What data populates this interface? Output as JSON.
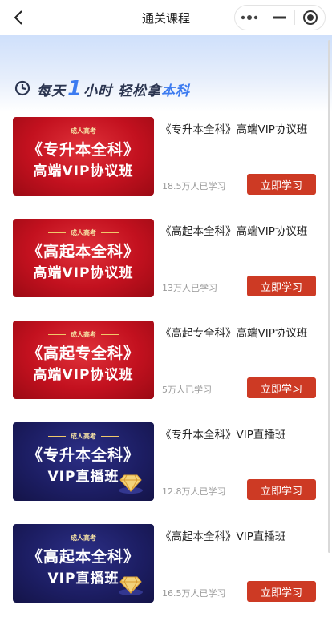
{
  "nav": {
    "title": "通关课程",
    "back_icon": "chevron-left-icon",
    "capsule": [
      "more-icon",
      "minimize-icon",
      "close-target-icon"
    ]
  },
  "slogan": {
    "prefix": "每天",
    "number": "1",
    "middle": "小时 轻松拿",
    "accent": "本科"
  },
  "courses": [
    {
      "cover_theme": "red",
      "cover_tag": "成人高考",
      "cover_line1": "《专升本全科》",
      "cover_line2": "高端VIP协议班",
      "title": "《专升本全科》高端VIP协议班",
      "learners": "18.5万人已学习",
      "button": "立即学习"
    },
    {
      "cover_theme": "red",
      "cover_tag": "成人高考",
      "cover_line1": "《高起本全科》",
      "cover_line2": "高端VIP协议班",
      "title": "《高起本全科》高端VIP协议班",
      "learners": "13万人已学习",
      "button": "立即学习"
    },
    {
      "cover_theme": "red",
      "cover_tag": "成人高考",
      "cover_line1": "《高起专全科》",
      "cover_line2": "高端VIP协议班",
      "title": "《高起专全科》高端VIP协议班",
      "learners": "5万人已学习",
      "button": "立即学习"
    },
    {
      "cover_theme": "blue",
      "cover_tag": "成人高考",
      "cover_line1": "《专升本全科》",
      "cover_line2": "VIP直播班",
      "title": "《专升本全科》VIP直播班",
      "learners": "12.8万人已学习",
      "button": "立即学习"
    },
    {
      "cover_theme": "blue",
      "cover_tag": "成人高考",
      "cover_line1": "《高起本全科》",
      "cover_line2": "VIP直播班",
      "title": "《高起本全科》VIP直播班",
      "learners": "16.5万人已学习",
      "button": "立即学习"
    }
  ],
  "colors": {
    "accent_blue": "#3c7bf0",
    "button_red": "#cd3a24",
    "cover_red": "#c3111f",
    "cover_blue": "#1c1d62"
  }
}
